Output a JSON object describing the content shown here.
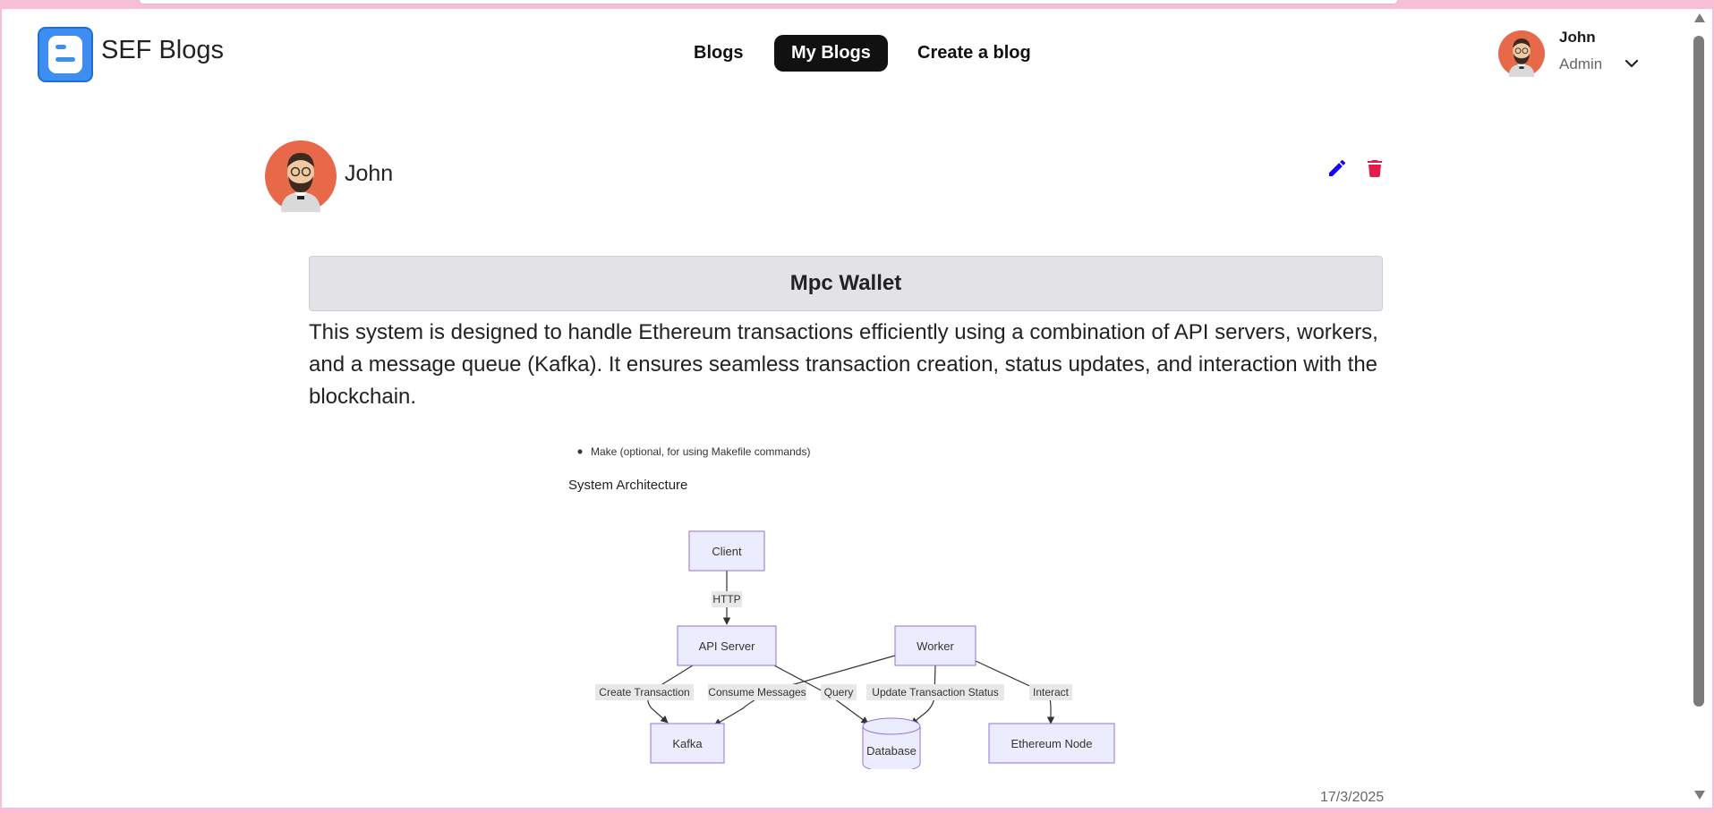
{
  "app": {
    "brand": "SEF Blogs"
  },
  "nav": {
    "blogs": "Blogs",
    "my_blogs": "My Blogs",
    "create_blog": "Create a blog"
  },
  "user": {
    "name": "John",
    "role": "Admin"
  },
  "post": {
    "author": "John",
    "title": "Mpc Wallet",
    "body": "This system is designed to handle Ethereum transactions efficiently using a combination of API servers, workers, and a message queue (Kafka). It ensures seamless transaction creation, status updates, and interaction with the blockchain.",
    "date": "17/3/2025"
  },
  "diagram": {
    "bullet": "Make (optional, for using Makefile commands)",
    "heading": "System Architecture",
    "nodes": {
      "client": "Client",
      "api_server": "API Server",
      "worker": "Worker",
      "kafka": "Kafka",
      "database": "Database",
      "ethereum_node": "Ethereum Node"
    },
    "edges": {
      "http": "HTTP",
      "create_transaction": "Create Transaction",
      "consume_messages": "Consume Messages",
      "query": "Query",
      "update_status": "Update Transaction Status",
      "interact": "Interact"
    }
  },
  "colors": {
    "accent_dark": "#111111",
    "edit_icon": "#1400ff",
    "delete_icon": "#e11d48",
    "logo_blue": "#3d8ef0",
    "diagram_node_fill": "#ececff",
    "diagram_node_stroke": "#9370db"
  }
}
